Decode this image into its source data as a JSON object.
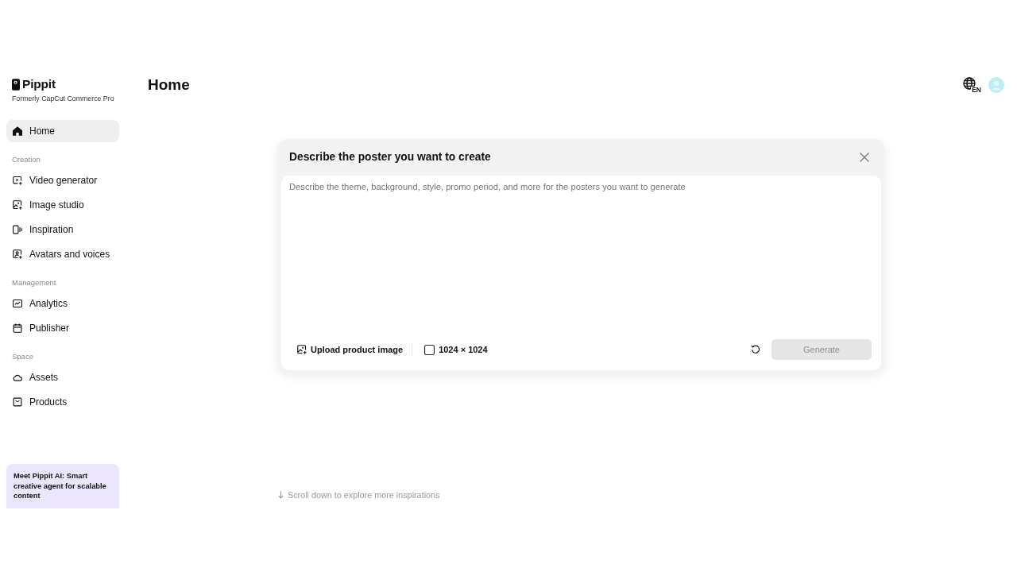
{
  "brand": {
    "name": "Pippit",
    "tagline": "Formerly CapCut Commerce Pro"
  },
  "sidebar": {
    "sections": [
      {
        "items": [
          {
            "label": "Home",
            "kind": "home",
            "selected": true
          }
        ]
      },
      {
        "heading": "Creation",
        "items": [
          {
            "label": "Video generator",
            "kind": "video",
            "selected": false
          },
          {
            "label": "Image studio",
            "kind": "image",
            "selected": false
          },
          {
            "label": "Inspiration",
            "kind": "inspiration",
            "selected": false
          },
          {
            "label": "Avatars and voices",
            "kind": "avatars",
            "selected": false
          }
        ]
      },
      {
        "heading": "Management",
        "items": [
          {
            "label": "Analytics",
            "kind": "analytics",
            "selected": false
          },
          {
            "label": "Publisher",
            "kind": "publisher",
            "selected": false
          }
        ]
      },
      {
        "heading": "Space",
        "items": [
          {
            "label": "Assets",
            "kind": "assets",
            "selected": false
          },
          {
            "label": "Products",
            "kind": "products",
            "selected": false
          }
        ]
      }
    ],
    "promo_card": {
      "text": "Meet Pippit AI: Smart creative agent for scalable content"
    }
  },
  "page": {
    "title": "Home"
  },
  "header_actions": {
    "language": "EN"
  },
  "prompt_dialog": {
    "title": "Describe the poster you want to create",
    "prompt": {
      "placeholder": "Describe the theme, background, style, promo period, and more for the posters you want to generate"
    },
    "upload_button": "Upload product image",
    "size_button": "1024 × 1024",
    "generate_button": {
      "label": "Generate",
      "disabled": true
    }
  },
  "scroll_hint": "Scroll down to explore more inspirations"
}
